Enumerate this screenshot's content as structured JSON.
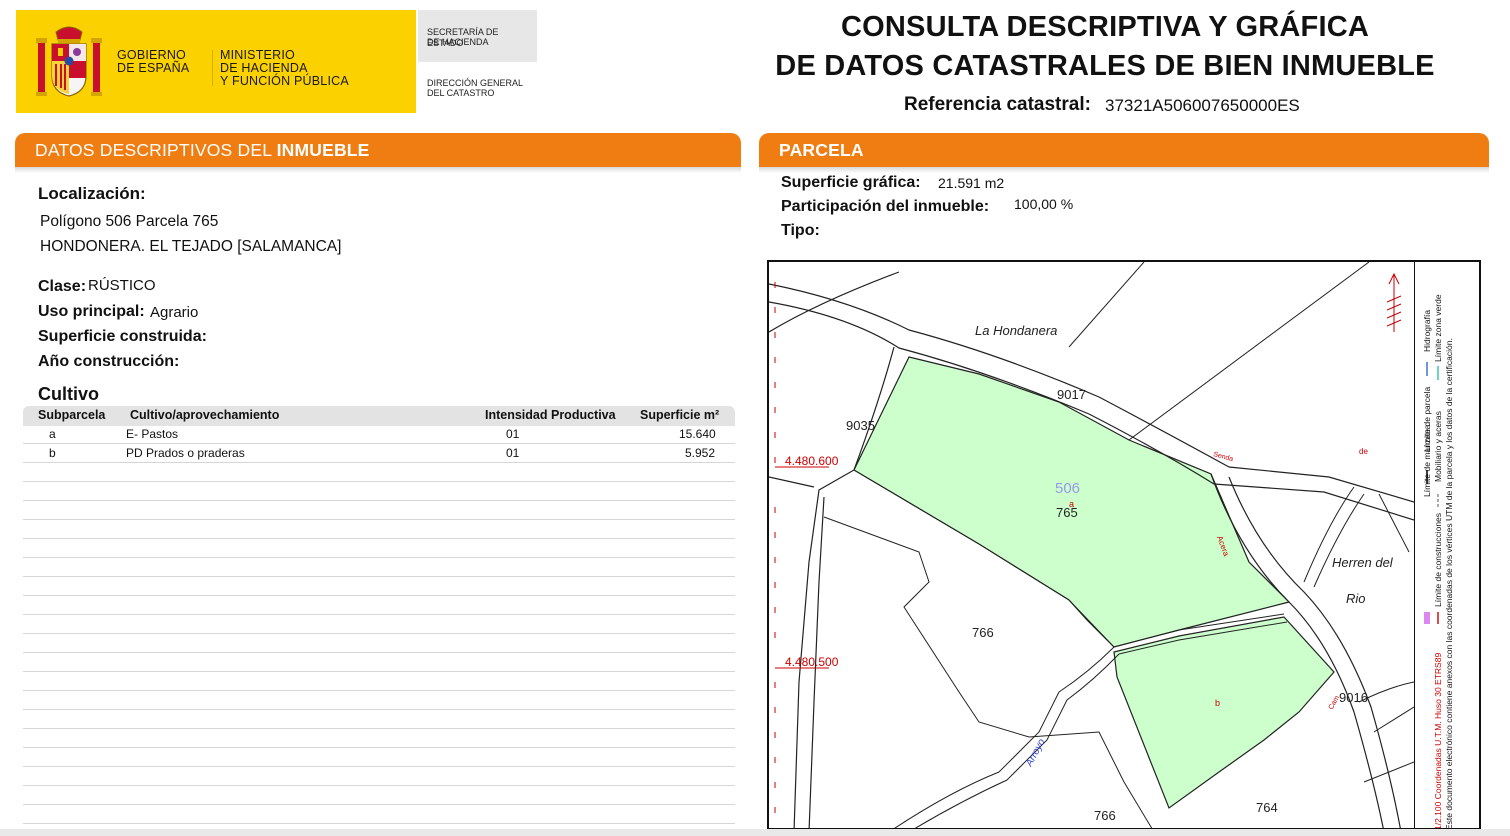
{
  "header": {
    "gov_line1": "GOBIERNO",
    "gov_line2": "DE ESPAÑA",
    "min_line1": "MINISTERIO",
    "min_line2": "DE HACIENDA",
    "min_line3": "Y FUNCIÓN PÚBLICA",
    "sec_line1": "SECRETARÍA DE ESTADO",
    "sec_line2": "DE HACIENDA",
    "dir_line1": "DIRECCIÓN GENERAL",
    "dir_line2": "DEL CATASTRO",
    "title_line1": "CONSULTA DESCRIPTIVA Y GRÁFICA",
    "title_line2": "DE DATOS CATASTRALES DE BIEN INMUEBLE",
    "ref_label": "Referencia catastral:",
    "ref_value": "37321A506007650000ES"
  },
  "descriptivos": {
    "heading_normal": "DATOS DESCRIPTIVOS DEL ",
    "heading_bold": "INMUEBLE",
    "localizacion_label": "Localización:",
    "localizacion_line1": "Polígono 506 Parcela 765",
    "localizacion_line2": "HONDONERA. EL TEJADO [SALAMANCA]",
    "clase_label": "Clase:",
    "clase_value": "RÚSTICO",
    "uso_label": "Uso principal:",
    "uso_value": "Agrario",
    "sup_construida_label": "Superficie construida:",
    "ano_label": "Año construcción:"
  },
  "cultivo": {
    "title": "Cultivo",
    "headers": [
      "Subparcela",
      "Cultivo/aprovechamiento",
      "Intensidad Productiva",
      "Superficie m²"
    ],
    "rows": [
      {
        "subparcela": "a",
        "cultivo": "E- Pastos",
        "intensidad": "01",
        "superficie": "15.640"
      },
      {
        "subparcela": "b",
        "cultivo": "PD Prados o praderas",
        "intensidad": "01",
        "superficie": "5.952"
      }
    ]
  },
  "parcela": {
    "heading": "PARCELA",
    "sup_grafica_label": "Superficie gráfica:",
    "sup_grafica_value": "21.591 m2",
    "participacion_label": "Participación del inmueble:",
    "participacion_value": "100,00 %",
    "tipo_label": "Tipo:"
  },
  "map": {
    "colors": {
      "parcel_fill": "#ccffcc",
      "coord_red": "#cc0000",
      "poligono_label": "#9999ee"
    },
    "place_la_hondanera": "La Hondanera",
    "place_herren": "Herren del",
    "place_rio": "Rio",
    "coord_y1": "4.480.600",
    "coord_y2": "4.480.500",
    "poligono_number": "506",
    "parcel_main": "765",
    "parcel_766_a": "766",
    "parcel_766_b": "766",
    "parcel_764": "764",
    "parcel_9035": "9035",
    "parcel_9017": "9017",
    "parcel_9016": "9016",
    "subparcel_a": "a",
    "subparcel_b": "b",
    "road_senda": "Senda",
    "road_de": "de",
    "road_acera": "Acera",
    "road_arroyo": "Arroyo",
    "road_cam": "Cam",
    "legend_limite_manzana": "Límite de manzana",
    "legend_limite_parcela": "Límite de parcela",
    "legend_hidrografia": "Hidrografía",
    "legend_limite_construcciones": "Límite de construcciones",
    "legend_mobiliario": "Mobiliario y aceras",
    "legend_zona_verde": "Límite zona verde",
    "legend_note": "Este documento electrónico contiene anexos con las coordenadas de los vértices UTM de la parcela y los datos de la certificación.",
    "legend_scale": "1/2.100 Coordenadas U.T.M. Huso 30 ETRS89"
  }
}
